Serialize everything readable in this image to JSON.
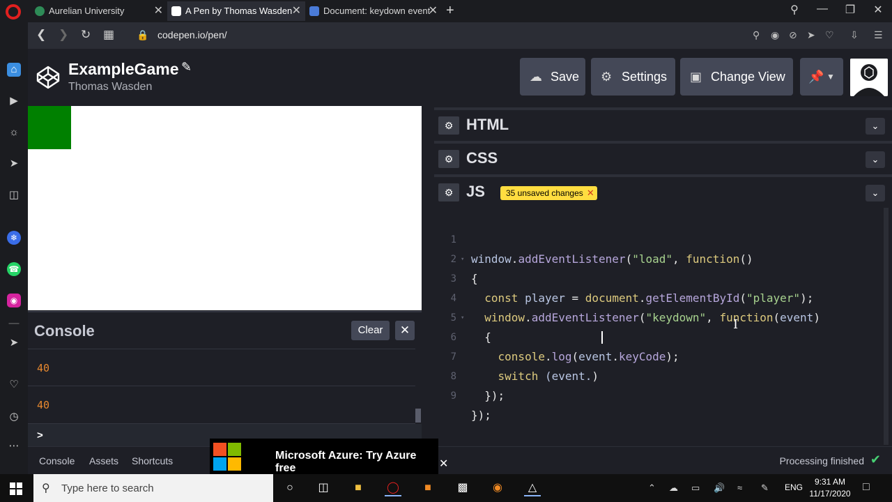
{
  "browser": {
    "tabs": [
      {
        "title": "Aurelian University",
        "favicon_color": "#2e8b57"
      },
      {
        "title": "A Pen by Thomas Wasden",
        "favicon_color": "#ffffff"
      },
      {
        "title": "Document: keydown event",
        "favicon_color": "#4a7bd8"
      }
    ],
    "new_tab": "+",
    "close_glyph": "✕",
    "url": "codepen.io/pen/"
  },
  "pen": {
    "title": "ExampleGame",
    "author": "Thomas Wasden"
  },
  "header": {
    "save_label": "Save",
    "settings_label": "Settings",
    "change_view_label": "Change View"
  },
  "console": {
    "title": "Console",
    "clear_label": "Clear",
    "close_glyph": "✕",
    "logs": [
      "40",
      "40"
    ],
    "prompt": ">"
  },
  "panes": {
    "html_title": "HTML",
    "css_title": "CSS",
    "js_title": "JS",
    "unsaved_badge": "35 unsaved changes"
  },
  "code": {
    "line_numbers": [
      "1",
      "2",
      "3",
      "4",
      "5",
      "6",
      "7",
      "8",
      "9"
    ]
  },
  "bottom": {
    "tabs": [
      "Console",
      "Assets",
      "Shortcuts"
    ],
    "ad_text": "Microsoft Azure: Try Azure free",
    "status": "Processing finished"
  },
  "taskbar": {
    "search_placeholder": "Type here to search",
    "language": "ENG",
    "time": "9:31 AM",
    "date": "11/17/2020"
  },
  "colors": {
    "player": "#008000",
    "badge": "#ffdd40",
    "success": "#47cf73"
  }
}
